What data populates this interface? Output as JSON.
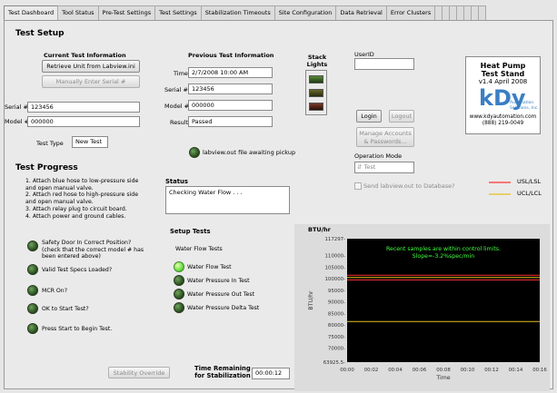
{
  "tabs": [
    {
      "label": "Test Dashboard",
      "active": true
    },
    {
      "label": "Tool Status"
    },
    {
      "label": "Pre-Test Settings"
    },
    {
      "label": "Test Settings"
    },
    {
      "label": "Stabilization Timeouts"
    },
    {
      "label": "Site Configuration"
    },
    {
      "label": "Data Retrieval"
    },
    {
      "label": "Error Clusters"
    }
  ],
  "test_setup": {
    "title": "Test Setup",
    "current": {
      "heading": "Current Test Information",
      "retrieve_button": "Retrieve Unit from Labview.ini",
      "manual_serial_button": "Manually Enter Serial #",
      "serial_label": "Serial #",
      "serial_value": "123456",
      "model_label": "Model #",
      "model_value": "000000",
      "test_type_label": "Test Type",
      "test_type_value": "New Test"
    },
    "previous": {
      "heading": "Previous Test Information",
      "time_label": "Time",
      "time_value": "2/7/2008 10:00 AM",
      "serial_label": "Serial #",
      "serial_value": "123456",
      "model_label": "Model #",
      "model_value": "000000",
      "result_label": "Result",
      "result_value": "Passed"
    },
    "stack_lights_label": "Stack Lights",
    "labview_led_label": "labview.out file awaiting pickup",
    "user": {
      "userid_label": "UserID",
      "userid_value": "",
      "login_button": "Login",
      "logout_button": "Logout",
      "manage_button_line1": "Manage Accounts",
      "manage_button_line2": "& Passwords...",
      "operation_mode_label": "Operation Mode",
      "operation_mode_value": "Test",
      "send_checkbox_label": "Send labview.out to Database?"
    },
    "logo": {
      "line1": "Heat Pump",
      "line2": "Test Stand",
      "line3": "v1.4 April 2008",
      "brand": "kDy",
      "brand_sub1": "Automation",
      "brand_sub2": "Solutions, Inc.",
      "website": "www.kdyautomation.com",
      "phone": "(888) 219-0049"
    }
  },
  "test_progress": {
    "title": "Test Progress",
    "instructions": [
      "1. Attach blue hose to low-pressure side",
      "and open manual valve.",
      "2. Attach red hose to high-pressure side",
      "and open manual valve.",
      "3. Attach relay plug to circuit board.",
      "4. Attach power and ground cables."
    ],
    "checks": [
      {
        "line1": "Safety Door In Correct Position?",
        "line2": "(check that the correct model # has",
        "line3": "been entered above)"
      },
      {
        "line1": "Valid Test Specs Loaded?"
      },
      {
        "line1": "MCR On?"
      },
      {
        "line1": "OK to Start Test?"
      },
      {
        "line1": "Press Start to Begin Test."
      }
    ],
    "status_label": "Status",
    "status_value": "Checking Water Flow . . .",
    "setup_tests_label": "Setup Tests",
    "water_flow_tests_label": "Water Flow Tests",
    "tests": [
      {
        "label": "Water Flow Test",
        "on": true
      },
      {
        "label": "Water Pressure In Test",
        "on": false
      },
      {
        "label": "Water Pressure Out Test",
        "on": false
      },
      {
        "label": "Water Pressure Delta Test",
        "on": false
      }
    ],
    "stability_button": "Stability Override",
    "time_remaining_line1": "Time Remaining",
    "time_remaining_line2": "for Stabilization",
    "time_remaining_value": "00:00:12"
  },
  "chart_data": {
    "type": "line",
    "ylabel_top": "BTU/hr",
    "ylabel": "BTU/hr",
    "xlabel": "Time",
    "ylim": [
      63925.5,
      117297
    ],
    "y_ticks": [
      "117297-",
      "110000-",
      "105000-",
      "100000-",
      "95000-",
      "90000-",
      "85000-",
      "80000-",
      "75000-",
      "70000-",
      "63925.5-"
    ],
    "y_tick_values": [
      117297,
      110000,
      105000,
      100000,
      95000,
      90000,
      85000,
      80000,
      75000,
      70000,
      63925.5
    ],
    "x_ticks": [
      "00:00",
      "00:02",
      "00:04",
      "00:06",
      "00:08",
      "00:10",
      "00:12",
      "00:14",
      "00:16"
    ],
    "annotation_line1": "Recent samples are within control limits.",
    "annotation_line2": "Slope=-3.2%spec/min",
    "legend": [
      {
        "name": "USL/LSL",
        "color": "#ff3030"
      },
      {
        "name": "UCL/LCL",
        "color": "#e8c020"
      }
    ],
    "series": [
      {
        "name": "USL/LSL",
        "color": "#ff3030",
        "values": [
          101500,
          99500
        ]
      },
      {
        "name": "UCL/LCL",
        "color": "#e8c020",
        "values": [
          100500,
          81500
        ]
      }
    ],
    "plot_bg": "#000000",
    "annotation_color": "#40ff40"
  }
}
